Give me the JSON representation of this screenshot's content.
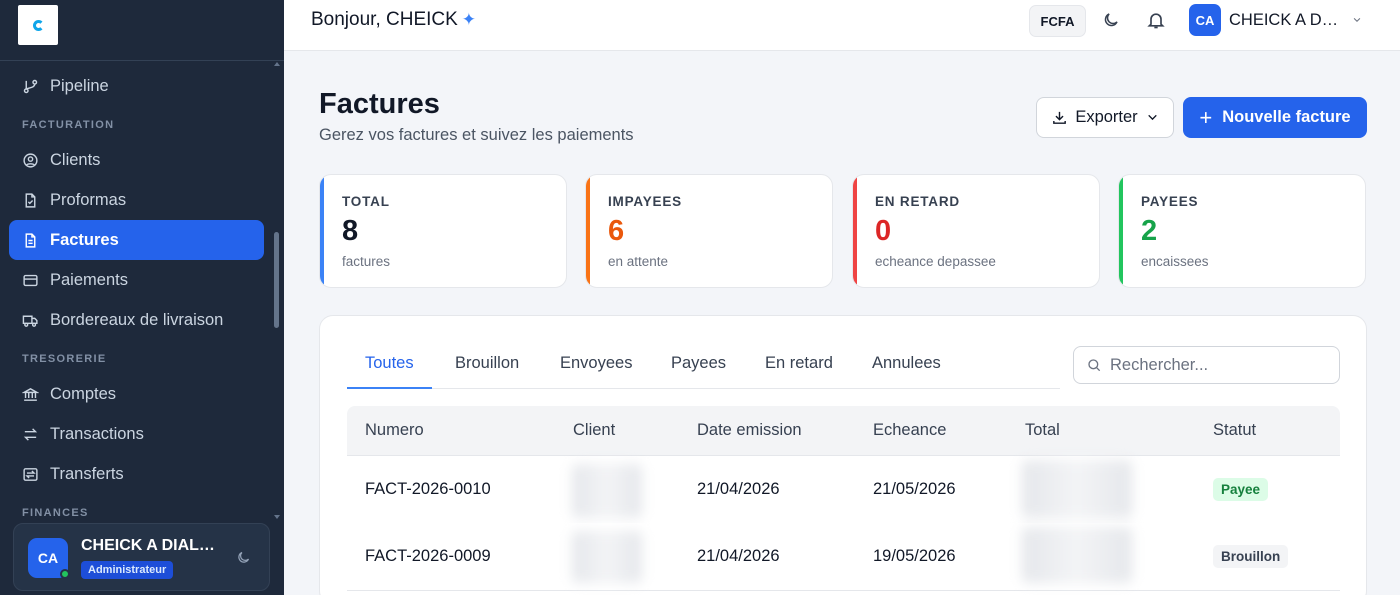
{
  "sidebar": {
    "items": [
      {
        "label": "Pipeline"
      },
      {
        "label": "Clients"
      },
      {
        "label": "Proformas"
      },
      {
        "label": "Factures"
      },
      {
        "label": "Paiements"
      },
      {
        "label": "Bordereaux de livraison"
      },
      {
        "label": "Comptes"
      },
      {
        "label": "Transactions"
      },
      {
        "label": "Transferts"
      }
    ],
    "sections": {
      "facturation": "FACTURATION",
      "tresorerie": "TRESORERIE",
      "finances": "FINANCES"
    },
    "active_item": "Factures",
    "user": {
      "initials": "CA",
      "name": "CHEICK A DIALLO",
      "role": "Administrateur"
    }
  },
  "topbar": {
    "greeting": "Bonjour, CHEICK",
    "greeting_icon": "sparkle-icon",
    "currency": "FCFA",
    "user_initials": "CA",
    "user_name": "CHEICK A DIALLO"
  },
  "page": {
    "title": "Factures",
    "subtitle": "Gerez vos factures et suivez les paiements",
    "export_label": "Exporter",
    "new_label": "Nouvelle facture"
  },
  "stats": [
    {
      "label": "TOTAL",
      "value": "8",
      "sub": "factures",
      "color": "#3b82f6"
    },
    {
      "label": "IMPAYEES",
      "value": "6",
      "sub": "en attente",
      "color": "#f97316"
    },
    {
      "label": "EN RETARD",
      "value": "0",
      "sub": "echeance depassee",
      "color": "#ef4444"
    },
    {
      "label": "PAYEES",
      "value": "2",
      "sub": "encaissees",
      "color": "#22c55e"
    }
  ],
  "tabs": [
    {
      "label": "Toutes"
    },
    {
      "label": "Brouillon"
    },
    {
      "label": "Envoyees"
    },
    {
      "label": "Payees"
    },
    {
      "label": "En retard"
    },
    {
      "label": "Annulees"
    }
  ],
  "active_tab": "Toutes",
  "search": {
    "placeholder": "Rechercher..."
  },
  "table": {
    "columns": [
      "Numero",
      "Client",
      "Date emission",
      "Echeance",
      "Total",
      "Statut"
    ],
    "rows": [
      {
        "numero": "FACT-2026-0010",
        "date_emission": "21/04/2026",
        "echeance": "21/05/2026",
        "statut": "Payee"
      },
      {
        "numero": "FACT-2026-0009",
        "date_emission": "21/04/2026",
        "echeance": "19/05/2026",
        "statut": "Brouillon"
      }
    ]
  }
}
